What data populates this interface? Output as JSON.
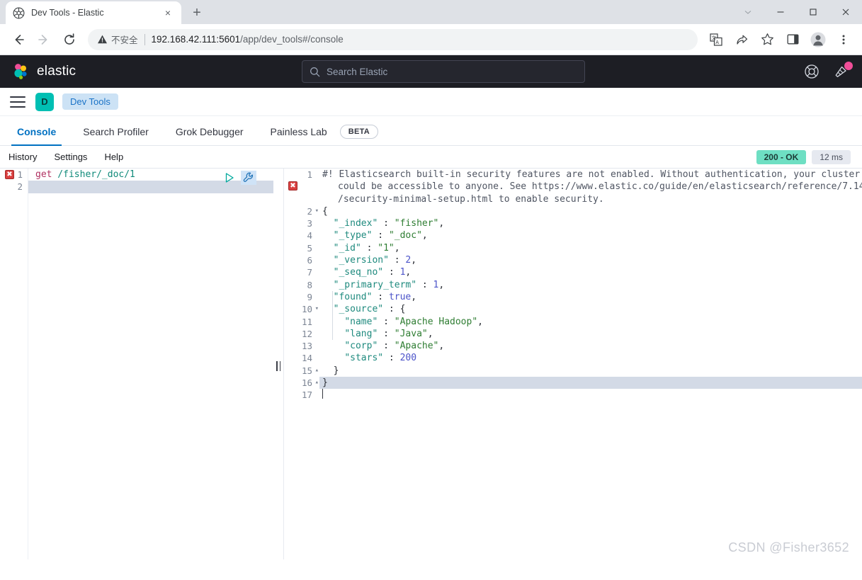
{
  "browser": {
    "tab": {
      "title": "Dev Tools - Elastic",
      "favicon": "elastic-favicon",
      "close": "×"
    },
    "new_tab_label": "+",
    "window_controls": {
      "restore_down": "⌄",
      "minimize": "—",
      "maximize": "□",
      "close": "✕"
    },
    "nav": {
      "back": "←",
      "forward": "→",
      "reload": "⟳"
    },
    "omnibox": {
      "security_label": "不安全",
      "url_host": "192.168.42.111:5601",
      "url_path": "/app/dev_tools",
      "url_hash": "#/console",
      "full_url": "192.168.42.111:5601/app/dev_tools#/console"
    },
    "toolbar_icons": [
      "translate-icon",
      "share-icon",
      "bookmark-star-icon",
      "side-panel-icon",
      "profile-avatar-icon",
      "chrome-menu-icon"
    ]
  },
  "elastic_header": {
    "brand": "elastic",
    "search_placeholder": "Search Elastic",
    "help_icon": "help-lifebuoy-icon",
    "news_icon": "news-announcement-icon",
    "has_notification": true,
    "accent_dot_color": "#f04e98",
    "background": "#1d1e24"
  },
  "breadcrumb": {
    "menu_label": "menu",
    "space_initial": "D",
    "space_color": "#00bfb3",
    "crumb": "Dev Tools"
  },
  "dev_tools_tabs": {
    "items": [
      {
        "label": "Console",
        "active": true
      },
      {
        "label": "Search Profiler",
        "active": false
      },
      {
        "label": "Grok Debugger",
        "active": false
      },
      {
        "label": "Painless Lab",
        "active": false
      }
    ],
    "beta_badge": "BETA",
    "active_color": "#0071c2"
  },
  "console_menu": {
    "items": [
      "History",
      "Settings",
      "Help"
    ],
    "status_code": "200 - OK",
    "status_color": "#6edfc3",
    "duration": "12 ms"
  },
  "request_editor": {
    "line_numbers": [
      "1",
      "2"
    ],
    "error_marker": "✖",
    "method": "get",
    "path": " /fisher/_doc/1",
    "play_icon": "play-triangle-icon",
    "wrench_icon": "wrench-icon",
    "active_line": 2
  },
  "response_editor": {
    "error_marker": "✖",
    "warning_lines": [
      "#! Elasticsearch built-in security features are not enabled. Without authentication, your cluster",
      "could be accessible to anyone. See https://www.elastic.co/guide/en/elasticsearch/reference/7.14",
      "/security-minimal-setup.html to enable security."
    ],
    "line_numbers": [
      "1",
      "2",
      "3",
      "4",
      "5",
      "6",
      "7",
      "8",
      "9",
      "10",
      "11",
      "12",
      "13",
      "14",
      "15",
      "16",
      "17"
    ],
    "fold_open": "▾",
    "fold_close": "▴",
    "json": {
      "open_brace": "{",
      "fields": [
        {
          "key": "\"_index\"",
          "sep": " : ",
          "value": "\"fisher\"",
          "type": "string",
          "comma": ","
        },
        {
          "key": "\"_type\"",
          "sep": " : ",
          "value": "\"_doc\"",
          "type": "string",
          "comma": ","
        },
        {
          "key": "\"_id\"",
          "sep": " : ",
          "value": "\"1\"",
          "type": "string",
          "comma": ","
        },
        {
          "key": "\"_version\"",
          "sep": " : ",
          "value": "2",
          "type": "number",
          "comma": ","
        },
        {
          "key": "\"_seq_no\"",
          "sep": " : ",
          "value": "1",
          "type": "number",
          "comma": ","
        },
        {
          "key": "\"_primary_term\"",
          "sep": " : ",
          "value": "1",
          "type": "number",
          "comma": ","
        },
        {
          "key": "\"found\"",
          "sep": " : ",
          "value": "true",
          "type": "bool",
          "comma": ","
        },
        {
          "key": "\"_source\"",
          "sep": " : ",
          "value": "{",
          "type": "object",
          "comma": ""
        }
      ],
      "source_fields": [
        {
          "key": "\"name\"",
          "sep": " : ",
          "value": "\"Apache Hadoop\"",
          "type": "string",
          "comma": ","
        },
        {
          "key": "\"lang\"",
          "sep": " : ",
          "value": "\"Java\"",
          "type": "string",
          "comma": ","
        },
        {
          "key": "\"corp\"",
          "sep": " : ",
          "value": "\"Apache\"",
          "type": "string",
          "comma": ","
        },
        {
          "key": "\"stars\"",
          "sep": " : ",
          "value": "200",
          "type": "number",
          "comma": ""
        }
      ],
      "close_inner": "}",
      "close_outer": "}"
    },
    "active_line": 17
  },
  "watermark": "CSDN @Fisher3652"
}
